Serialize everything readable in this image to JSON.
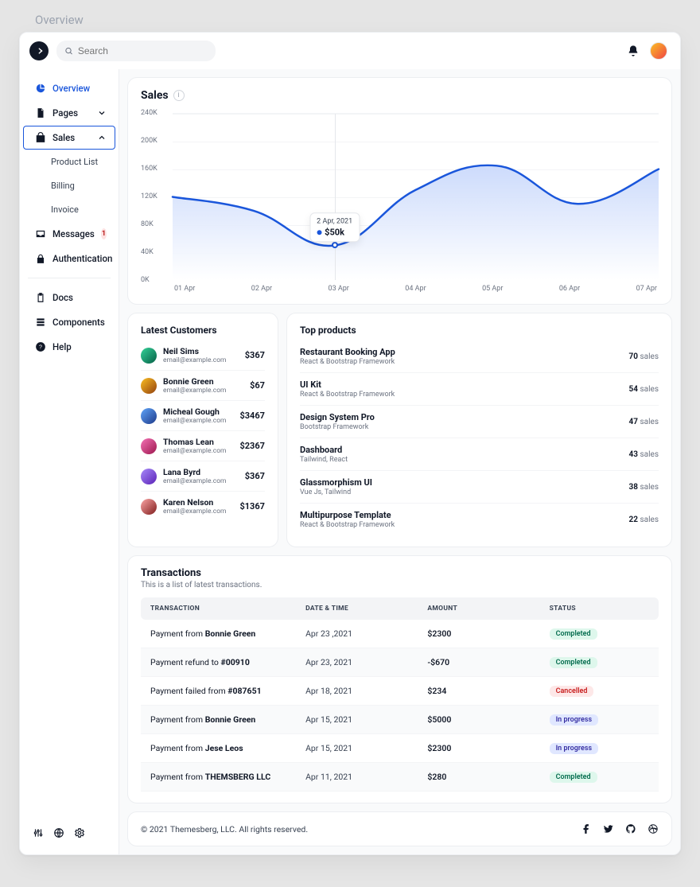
{
  "outer_label": "Overview",
  "search": {
    "placeholder": "Search"
  },
  "nav": {
    "overview": "Overview",
    "pages": "Pages",
    "sales": "Sales",
    "sales_children": {
      "product_list": "Product List",
      "billing": "Billing",
      "invoice": "Invoice"
    },
    "messages": "Messages",
    "messages_badge": "1",
    "auth": "Authentication",
    "docs": "Docs",
    "components": "Components",
    "help": "Help"
  },
  "sales_card": {
    "title": "Sales",
    "tooltip_date": "2 Apr, 2021",
    "tooltip_value": "$50k",
    "yticks": [
      "240K",
      "200K",
      "160K",
      "120K",
      "80K",
      "40K",
      "0K"
    ],
    "xlabels": [
      "01 Apr",
      "02 Apr",
      "03 Apr",
      "04 Apr",
      "05 Apr",
      "06 Apr",
      "07 Apr"
    ]
  },
  "chart_data": {
    "type": "line",
    "title": "Sales",
    "xlabel": "",
    "ylabel": "",
    "ylim": [
      0,
      240
    ],
    "y_unit": "K",
    "categories": [
      "01 Apr",
      "02 Apr",
      "03 Apr",
      "04 Apr",
      "05 Apr",
      "06 Apr",
      "07 Apr"
    ],
    "values": [
      120,
      100,
      50,
      130,
      165,
      110,
      160
    ],
    "highlight": {
      "index": 2,
      "label": "2 Apr, 2021",
      "display": "$50k"
    }
  },
  "customers": {
    "title": "Latest Customers",
    "rows": [
      {
        "name": "Neil Sims",
        "email": "email@example.com",
        "amount": "$367"
      },
      {
        "name": "Bonnie Green",
        "email": "email@example.com",
        "amount": "$67"
      },
      {
        "name": "Micheal Gough",
        "email": "email@example.com",
        "amount": "$3467"
      },
      {
        "name": "Thomas Lean",
        "email": "email@example.com",
        "amount": "$2367"
      },
      {
        "name": "Lana Byrd",
        "email": "email@example.com",
        "amount": "$367"
      },
      {
        "name": "Karen Nelson",
        "email": "email@example.com",
        "amount": "$1367"
      }
    ]
  },
  "products": {
    "title": "Top products",
    "sales_suffix": " sales",
    "rows": [
      {
        "name": "Restaurant Booking App",
        "sub": "React & Bootstrap Framework",
        "count": "70"
      },
      {
        "name": "UI Kit",
        "sub": "React & Bootstrap Framework",
        "count": "54"
      },
      {
        "name": "Design System Pro",
        "sub": "Bootstrap Framework",
        "count": "47"
      },
      {
        "name": "Dashboard",
        "sub": "Tailwind, React",
        "count": "43"
      },
      {
        "name": "Glassmorphism UI",
        "sub": "Vue Js, Tailwind",
        "count": "38"
      },
      {
        "name": "Multipurpose Template",
        "sub": "React & Bootstrap Framework",
        "count": "22"
      }
    ]
  },
  "transactions": {
    "title": "Transactions",
    "subtitle": "This is a list of latest transactions.",
    "headers": {
      "c1": "Transaction",
      "c2": "Date & Time",
      "c3": "Amount",
      "c4": "Status"
    },
    "rows": [
      {
        "pre": "Payment from ",
        "who": "Bonnie Green",
        "date": "Apr 23 ,2021",
        "amount": "$2300",
        "status": "Completed",
        "sclass": "st-completed"
      },
      {
        "pre": "Payment refund to ",
        "who": "#00910",
        "date": "Apr 23, 2021",
        "amount": "-$670",
        "status": "Completed",
        "sclass": "st-completed"
      },
      {
        "pre": "Payment failed from ",
        "who": "#087651",
        "date": "Apr 18, 2021",
        "amount": "$234",
        "status": "Cancelled",
        "sclass": "st-cancelled"
      },
      {
        "pre": "Payment from ",
        "who": "Bonnie Green",
        "date": "Apr 15, 2021",
        "amount": "$5000",
        "status": "In progress",
        "sclass": "st-progress"
      },
      {
        "pre": "Payment from ",
        "who": "Jese Leos",
        "date": "Apr 15, 2021",
        "amount": "$2300",
        "status": "In progress",
        "sclass": "st-progress"
      },
      {
        "pre": "Payment from ",
        "who": "THEMSBERG LLC",
        "date": "Apr 11, 2021",
        "amount": "$280",
        "status": "Completed",
        "sclass": "st-completed"
      }
    ]
  },
  "footer": {
    "copyright": "© 2021 Themesberg, LLC. All rights reserved."
  }
}
